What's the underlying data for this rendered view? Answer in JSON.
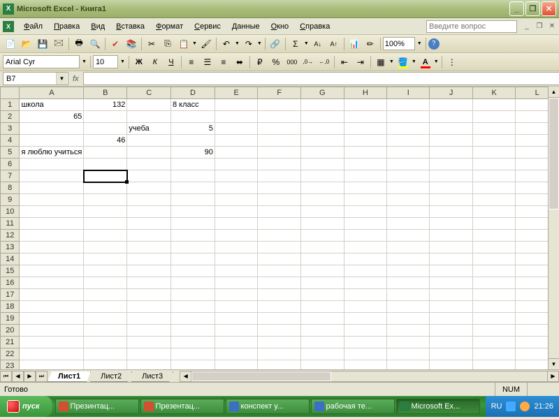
{
  "titlebar": {
    "title": "Microsoft Excel - Книга1"
  },
  "menu": {
    "items": [
      {
        "u": "Ф",
        "rest": "айл"
      },
      {
        "u": "П",
        "rest": "равка"
      },
      {
        "u": "В",
        "rest": "ид"
      },
      {
        "u": "В",
        "rest": "ставка"
      },
      {
        "u": "Ф",
        "rest": "ормат"
      },
      {
        "u": "С",
        "rest": "ервис"
      },
      {
        "u": "Д",
        "rest": "анные"
      },
      {
        "u": "О",
        "rest": "кно"
      },
      {
        "u": "С",
        "rest": "правка"
      }
    ],
    "ask_placeholder": "Введите вопрос"
  },
  "toolbar": {
    "font": "Arial Cyr",
    "size": "10",
    "zoom": "100%"
  },
  "formulabar": {
    "cellref": "B7",
    "fx": "fx",
    "formula": ""
  },
  "columns": [
    "A",
    "B",
    "C",
    "D",
    "E",
    "F",
    "G",
    "H",
    "I",
    "J",
    "K",
    "L"
  ],
  "rows": [
    "1",
    "2",
    "3",
    "4",
    "5",
    "6",
    "7",
    "8",
    "9",
    "10",
    "11",
    "12",
    "13",
    "14",
    "15",
    "16",
    "17",
    "18",
    "19",
    "20",
    "21",
    "22",
    "23"
  ],
  "cells": {
    "r1": {
      "A": "школа",
      "B": "132",
      "D": "8 класс"
    },
    "r2": {
      "A": "65"
    },
    "r3": {
      "C": "учеба",
      "D": "5"
    },
    "r4": {
      "B": "46"
    },
    "r5": {
      "A": "я люблю учиться",
      "D": "90"
    }
  },
  "selected": {
    "row": 7,
    "col": "B"
  },
  "sheets": {
    "active": "Лист1",
    "others": [
      "Лист2",
      "Лист3"
    ]
  },
  "status": {
    "ready": "Готово",
    "num": "NUM"
  },
  "taskbar": {
    "start": "пуск",
    "tasks": [
      {
        "label": "Презинтац...",
        "icon": "p"
      },
      {
        "label": "Презентац...",
        "icon": "p"
      },
      {
        "label": "конспект у...",
        "icon": "w"
      },
      {
        "label": "рабочая те...",
        "icon": "w"
      },
      {
        "label": "Microsoft Ex...",
        "icon": "x",
        "active": true
      }
    ],
    "lang": "RU",
    "time": "21:26"
  }
}
